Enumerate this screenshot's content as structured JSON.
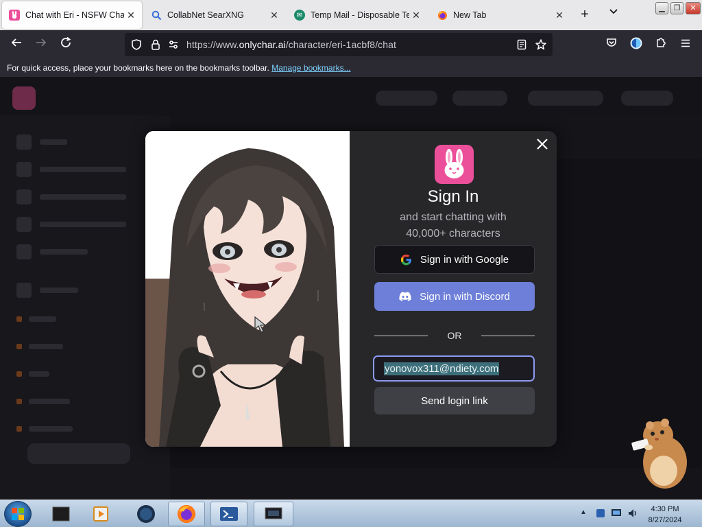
{
  "browser": {
    "tabs": [
      {
        "title": "Chat with Eri - NSFW Charac",
        "active": true,
        "favicon": "onlychar-icon"
      },
      {
        "title": "CollabNet SearXNG",
        "active": false,
        "favicon": "search-icon"
      },
      {
        "title": "Temp Mail - Disposable Tem",
        "active": false,
        "favicon": "tempmail-icon"
      },
      {
        "title": "New Tab",
        "active": false,
        "favicon": "firefox-icon"
      }
    ],
    "url_prefix": "https://www.",
    "url_domain": "onlychar.ai",
    "url_path": "/character/eri-1acbf8/chat",
    "bookmarks_message": "For quick access, place your bookmarks here on the bookmarks toolbar.",
    "bookmarks_link": "Manage bookmarks..."
  },
  "modal": {
    "title": "Sign In",
    "subtitle_line1": "and start chatting with",
    "subtitle_line2": "40,000+ characters",
    "google_label": "Sign in with Google",
    "discord_label": "Sign in with Discord",
    "divider_label": "OR",
    "email_value": "yonovox311@ndiety.com",
    "send_link_label": "Send login link"
  },
  "taskbar": {
    "time": "4:30 PM",
    "date": "8/27/2024"
  },
  "colors": {
    "brand_pink": "#ec4f9a",
    "discord_blue": "#6d7fd8",
    "modal_bg": "#27272a",
    "focus_ring": "#8c9bf0"
  }
}
